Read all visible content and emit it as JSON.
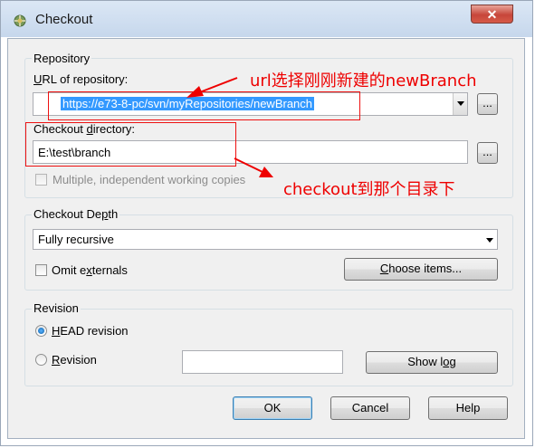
{
  "window": {
    "title": "Checkout",
    "close_glyph": "✕"
  },
  "repository": {
    "group_label": "Repository",
    "url_label": "URL of repository:",
    "url_value": "https://e73-8-pc/svn/myRepositories/newBranch",
    "browse_label": "...",
    "dir_label": "Checkout directory:",
    "dir_value": "E:\\test\\branch",
    "dir_browse_label": "...",
    "multiple_label": "Multiple, independent working copies"
  },
  "depth": {
    "group_label": "Checkout Depth",
    "selected": "Fully recursive",
    "omit_label": "Omit externals",
    "choose_label": "Choose items..."
  },
  "revision": {
    "group_label": "Revision",
    "head_label": "HEAD revision",
    "revision_label": "Revision",
    "show_log_label": "Show log"
  },
  "buttons": {
    "ok": "OK",
    "cancel": "Cancel",
    "help": "Help"
  },
  "annotations": {
    "url_note": "url选择刚刚新建的newBranch",
    "dir_note": "checkout到那个目录下"
  },
  "colors": {
    "annotation": "#ee0000",
    "selection": "#3399ff",
    "title_bg": "#c6d7ec"
  },
  "icons": {
    "app": "tortoise-icon",
    "close": "close-icon",
    "dropdown": "chevron-down-icon",
    "arrow": "red-arrow-icon"
  }
}
